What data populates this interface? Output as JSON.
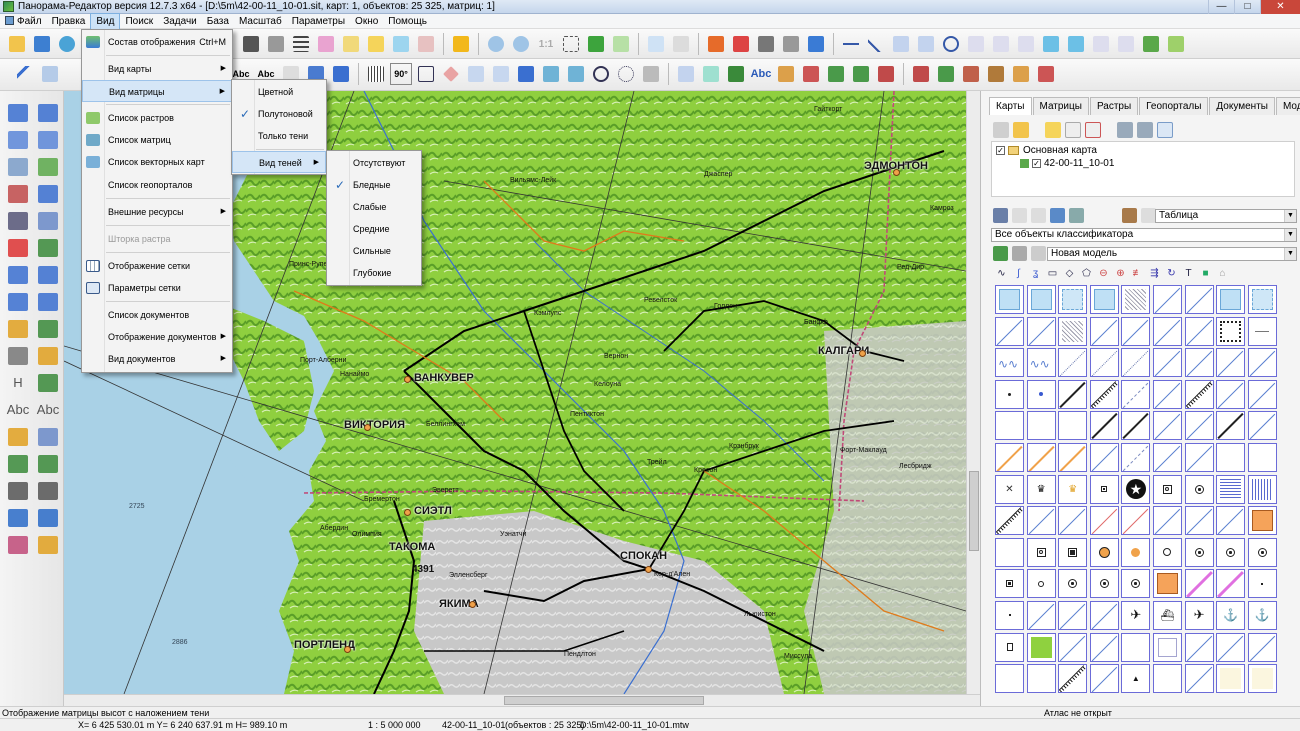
{
  "window": {
    "title": "Панорама-Редактор версия 12.7.3 x64 - [D:\\5m\\42-00-11_10-01.sit, карт: 1, объектов: 25 325, матриц: 1]",
    "minimize": "—",
    "maximize": "□",
    "close": "✕"
  },
  "menubar": {
    "items": [
      "Файл",
      "Правка",
      "Вид",
      "Поиск",
      "Задачи",
      "База",
      "Масштаб",
      "Параметры",
      "Окно",
      "Помощь"
    ]
  },
  "view_menu": {
    "items": [
      {
        "label": "Состав отображения",
        "shortcut": "Ctrl+M",
        "icon": "layers-icon"
      },
      {
        "label": "Вид карты",
        "submenu": true
      },
      {
        "label": "Вид матрицы",
        "submenu": true,
        "highlighted": true
      },
      {
        "label": "Список растров",
        "icon": "raster-list-icon"
      },
      {
        "label": "Список  матриц",
        "icon": "matrix-list-icon"
      },
      {
        "label": "Список векторных карт",
        "icon": "vector-list-icon"
      },
      {
        "label": "Список геопорталов"
      },
      {
        "label": "Внешние ресурсы",
        "submenu": true
      },
      {
        "label": "Шторка растра",
        "disabled": true
      },
      {
        "label": "Отображение сетки",
        "icon": "grid-icon"
      },
      {
        "label": "Параметры сетки",
        "icon": "grid-settings-icon"
      },
      {
        "label": "Список документов"
      },
      {
        "label": "Отображение документов",
        "submenu": true
      },
      {
        "label": "Вид  документов",
        "submenu": true
      }
    ]
  },
  "matrix_submenu": {
    "items": [
      {
        "label": "Цветной"
      },
      {
        "label": "Полутоновой",
        "checked": true
      },
      {
        "label": "Только тени"
      },
      {
        "label": "Вид теней",
        "submenu": true,
        "highlighted": true
      }
    ]
  },
  "shadow_submenu": {
    "items": [
      {
        "label": "Отсутствуют"
      },
      {
        "label": "Бледные",
        "checked": true
      },
      {
        "label": "Слабые"
      },
      {
        "label": "Средние"
      },
      {
        "label": "Сильные"
      },
      {
        "label": "Глубокие"
      }
    ]
  },
  "map": {
    "cities": [
      "ЭДМОНТОН",
      "КАЛГАРИ",
      "ВАНКУВЕР",
      "ВИКТОРИЯ",
      "СИЭТЛ",
      "ТАКОМА",
      "СПОКАН",
      "ЯКИМА",
      "ПОРТЛЕНД"
    ],
    "places": [
      "Вильямс-Лейк",
      "Джаспер",
      "Кэмлупс",
      "Пентиктон",
      "Келоуна",
      "Вернон",
      "Банфф",
      "Голден",
      "Крэнбрук",
      "Ревелсток",
      "Принс-Руперт",
      "Порт-Алберни",
      "Нанаймо",
      "Беллингхем",
      "Эверетт",
      "Бремертон",
      "Олимпия",
      "Абердин",
      "Кер-д'Ален",
      "Льюистон",
      "Пендлтон",
      "Уэнатчи",
      "Элленсберг",
      "Форт-Маклауд",
      "Лесбридж",
      "Камроз",
      "Ред-Дир",
      "Гайткорт",
      "Кресон",
      "Трейл",
      "Миссула"
    ],
    "labels": {
      "elev": "4391",
      "depth": "2725",
      "depth2": "2886"
    }
  },
  "right_panel": {
    "tabs": [
      "Карты",
      "Матрицы",
      "Растры",
      "Геопорталы",
      "Документы",
      "Модели"
    ],
    "tree": {
      "root": "Основная карта",
      "child": "42-00-11_10-01"
    },
    "view_combo": "Таблица",
    "filter_combo": "Все объекты классификатора",
    "model_combo": "Новая модель"
  },
  "status": {
    "hint": "Отображение матрицы высот с наложением тени",
    "atlas": "Атлас не открыт",
    "coords": "X= 6 425 530.01 m  Y= 6 240 637.91 m  H=   989.10 m",
    "scale": "1 : 5 000 000",
    "mapname": "42-00-11_10-01",
    "objects": "(объектов : 25 325)",
    "path": "D:\\5m\\42-00-11_10-01.mtw"
  },
  "colors": {
    "land": "#8fcf3f",
    "relief": "#5a9e28",
    "gray_land": "#c8c8c8",
    "sea": "#a9d1e6",
    "road": "#000000",
    "border": "#c04a78",
    "city_dot": "#f0a24a",
    "menu_highlight": "#d5e6f7"
  }
}
